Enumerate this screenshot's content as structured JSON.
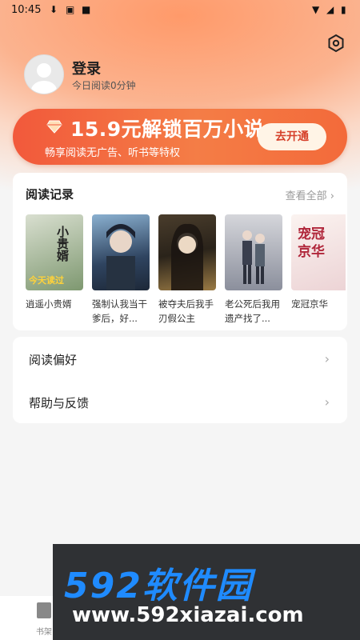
{
  "status_bar": {
    "time": "10:45"
  },
  "profile": {
    "login_label": "登录",
    "reading_today": "今日阅读0分钟"
  },
  "vip_banner": {
    "price_text": "15.9元解锁百万小说",
    "description": "畅享阅读无广告、听书等特权",
    "button_label": "去开通"
  },
  "reading_history": {
    "title": "阅读记录",
    "see_all": "查看全部 ›",
    "books": [
      {
        "title": "逍遥小贵婿",
        "cover_text": "小贵婿",
        "cover_badge": "今天读过",
        "colors": [
          "#c9d3c1",
          "#8aa07a"
        ]
      },
      {
        "title": "强制认我当干爹后，好...",
        "colors": [
          "#5b7c9a",
          "#2a3a4e"
        ]
      },
      {
        "title": "被夺夫后我手刃假公主",
        "colors": [
          "#3b3226",
          "#8a6a3c"
        ]
      },
      {
        "title": "老公死后我用遗产找了...",
        "colors": [
          "#c8c9cf",
          "#6a6e7c"
        ]
      },
      {
        "title": "宠冠京华",
        "cover_text": "宠冠京华",
        "colors": [
          "#f6ece8",
          "#e9cfd1"
        ]
      }
    ]
  },
  "menu": {
    "items": [
      {
        "label": "阅读偏好",
        "chevron": "›"
      },
      {
        "label": "帮助与反馈",
        "chevron": "›"
      }
    ]
  },
  "bottom_tab": {
    "label": "书架"
  },
  "watermark": {
    "big": "592软件园",
    "url": "www.592xiazai.com"
  }
}
